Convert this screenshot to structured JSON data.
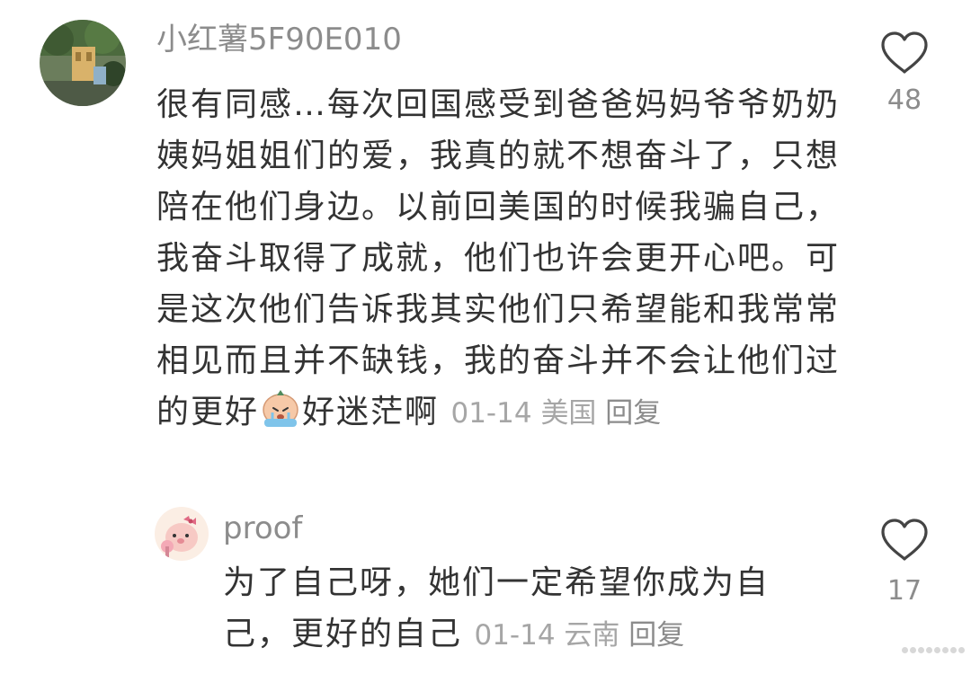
{
  "comments": [
    {
      "username": "小红薯5F90E010",
      "text": "很有同感…每次回国感受到爸爸妈妈爷爷奶奶姨妈姐姐们的爱，我真的就不想奋斗了，只想陪在他们身边。以前回美国的时候我骗自己，我奋斗取得了成就，他们也许会更开心吧。可是这次他们告诉我其实他们只希望能和我常常相见而且并不缺钱，我的奋斗并不会让他们过的更好",
      "text_after_emoji": "好迷茫啊",
      "emoji_icon": "crying-face-emoji-icon",
      "date": "01-14",
      "location": "美国",
      "reply_label": "回复",
      "likes": "48"
    }
  ],
  "reply": {
    "username": "proof",
    "text": "为了自己呀，她们一定希望你成为自己，更好的自己",
    "date": "01-14",
    "location": "云南",
    "reply_label": "回复",
    "likes": "17"
  },
  "icons": {
    "like": "heart-outline-icon"
  },
  "colors": {
    "text": "#333333",
    "meta": "#a6a6a6",
    "username": "#8c8c8c"
  }
}
